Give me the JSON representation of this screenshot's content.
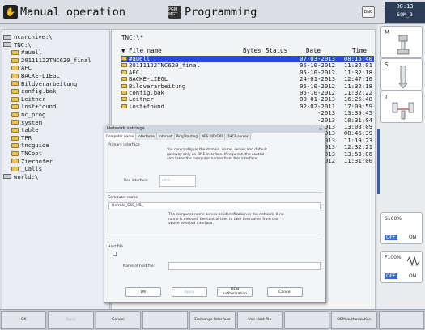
{
  "header": {
    "mode_left": "Manual operation",
    "mode_right": "Programming",
    "dnc_label": "DNC",
    "pgm_label": "PGM MGT",
    "time": "08:13",
    "mode_short": "SOM_3"
  },
  "tree": {
    "items": [
      {
        "label": "ncarchive:\\",
        "indent": 0,
        "kind": "drive"
      },
      {
        "label": "TNC:\\",
        "indent": 0,
        "kind": "drive"
      },
      {
        "label": "#auell",
        "indent": 1,
        "kind": "folder"
      },
      {
        "label": "20111122TNC620_final",
        "indent": 1,
        "kind": "folder"
      },
      {
        "label": "AFC",
        "indent": 1,
        "kind": "folder"
      },
      {
        "label": "BACKE-LIEGL",
        "indent": 1,
        "kind": "folder"
      },
      {
        "label": "Bildverarbeitung",
        "indent": 1,
        "kind": "folder"
      },
      {
        "label": "config.bak",
        "indent": 1,
        "kind": "folder"
      },
      {
        "label": "Leitner",
        "indent": 1,
        "kind": "folder"
      },
      {
        "label": "lost+found",
        "indent": 1,
        "kind": "folder"
      },
      {
        "label": "nc_prog",
        "indent": 1,
        "kind": "folder"
      },
      {
        "label": "system",
        "indent": 1,
        "kind": "folder"
      },
      {
        "label": "table",
        "indent": 1,
        "kind": "folder"
      },
      {
        "label": "TFR",
        "indent": 1,
        "kind": "folder"
      },
      {
        "label": "tncguide",
        "indent": 1,
        "kind": "folder"
      },
      {
        "label": "TNCopt",
        "indent": 1,
        "kind": "folder"
      },
      {
        "label": "Zierhofer",
        "indent": 1,
        "kind": "folder"
      },
      {
        "label": "_Calls",
        "indent": 1,
        "kind": "folder"
      },
      {
        "label": "world:\\",
        "indent": 0,
        "kind": "drive"
      }
    ]
  },
  "files": {
    "path": "TNC:\\*",
    "columns": [
      "File name",
      "Bytes",
      "Status",
      "Date",
      "Time"
    ],
    "rows": [
      {
        "name": "#auell",
        "date": "07-03-2013",
        "time": "08:16:40",
        "selected": true
      },
      {
        "name": "20111122TNC620_final",
        "date": "05-10-2012",
        "time": "11:32:01"
      },
      {
        "name": "AFC",
        "date": "05-10-2012",
        "time": "11:32:18"
      },
      {
        "name": "BACKE-LIEGL",
        "date": "24-01-2013",
        "time": "12:47:10"
      },
      {
        "name": "Bildverarbeitung",
        "date": "05-10-2012",
        "time": "11:32:18"
      },
      {
        "name": "config.bak",
        "date": "05-10-2012",
        "time": "11:32:22"
      },
      {
        "name": "Leitner",
        "date": "08-01-2013",
        "time": "16:25:48"
      },
      {
        "name": "lost+found",
        "date": "02-02-2011",
        "time": "17:09:59"
      },
      {
        "name": "",
        "date": "-2013",
        "time": "13:39:45"
      },
      {
        "name": "",
        "date": "-2013",
        "time": "10:31:04"
      },
      {
        "name": "",
        "date": "-2013",
        "time": "13:03:09"
      },
      {
        "name": "",
        "date": "-2013",
        "time": "08:46:39"
      },
      {
        "name": "",
        "date": "-2013",
        "time": "11:19:23"
      },
      {
        "name": "",
        "date": "-2013",
        "time": "12:32:21"
      },
      {
        "name": "",
        "date": "-2013",
        "time": "13:53:06"
      },
      {
        "name": "",
        "date": "-2012",
        "time": "11:31:00"
      }
    ]
  },
  "dialog": {
    "title": "Network settings",
    "tabs": [
      "Computer name",
      "Interfaces",
      "Internet",
      "Ping/Routing",
      "NFS UID/GID",
      "DHCP server"
    ],
    "primary_label": "Primary interface",
    "primary_desc": "You can configure the domain, name, server and default gateway only on ONE interface. If required, the control also takes the computer names from this interface.",
    "use_iface_label": "Use interface:",
    "use_iface_value": "eth0",
    "computer_name_label": "Computer name",
    "computer_name_value": "Hermle_C40_H5_",
    "computer_name_desc": "The computer name serves as identification in the network. If no name is entered, the control tries to take the names from the above selected interface.",
    "hostfile_label": "Host file",
    "use_hostfile_label": "Use host file",
    "hostfile_name_label": "Name of host file:",
    "buttons": {
      "ok": "OK",
      "apply": "Apply",
      "oem": "OEM authorization",
      "cancel": "Cancel"
    }
  },
  "right": {
    "btn1": "M",
    "btn2": "S",
    "btn3": "T",
    "feed_pct": "S100%",
    "feed_off": "OFF",
    "feed_on": "ON",
    "rapid_pct": "F100%",
    "rapid_off": "OFF",
    "rapid_on": "ON"
  },
  "softkeys": [
    {
      "label": "OK",
      "enabled": true
    },
    {
      "label": "Apply",
      "enabled": false
    },
    {
      "label": "Cancel",
      "enabled": true
    },
    {
      "label": "",
      "enabled": true
    },
    {
      "label": "Exchange Interface",
      "enabled": true
    },
    {
      "label": "Use Host file",
      "enabled": true
    },
    {
      "label": "",
      "enabled": true
    },
    {
      "label": "OEM authorization",
      "enabled": true
    },
    {
      "label": "",
      "enabled": true
    }
  ]
}
